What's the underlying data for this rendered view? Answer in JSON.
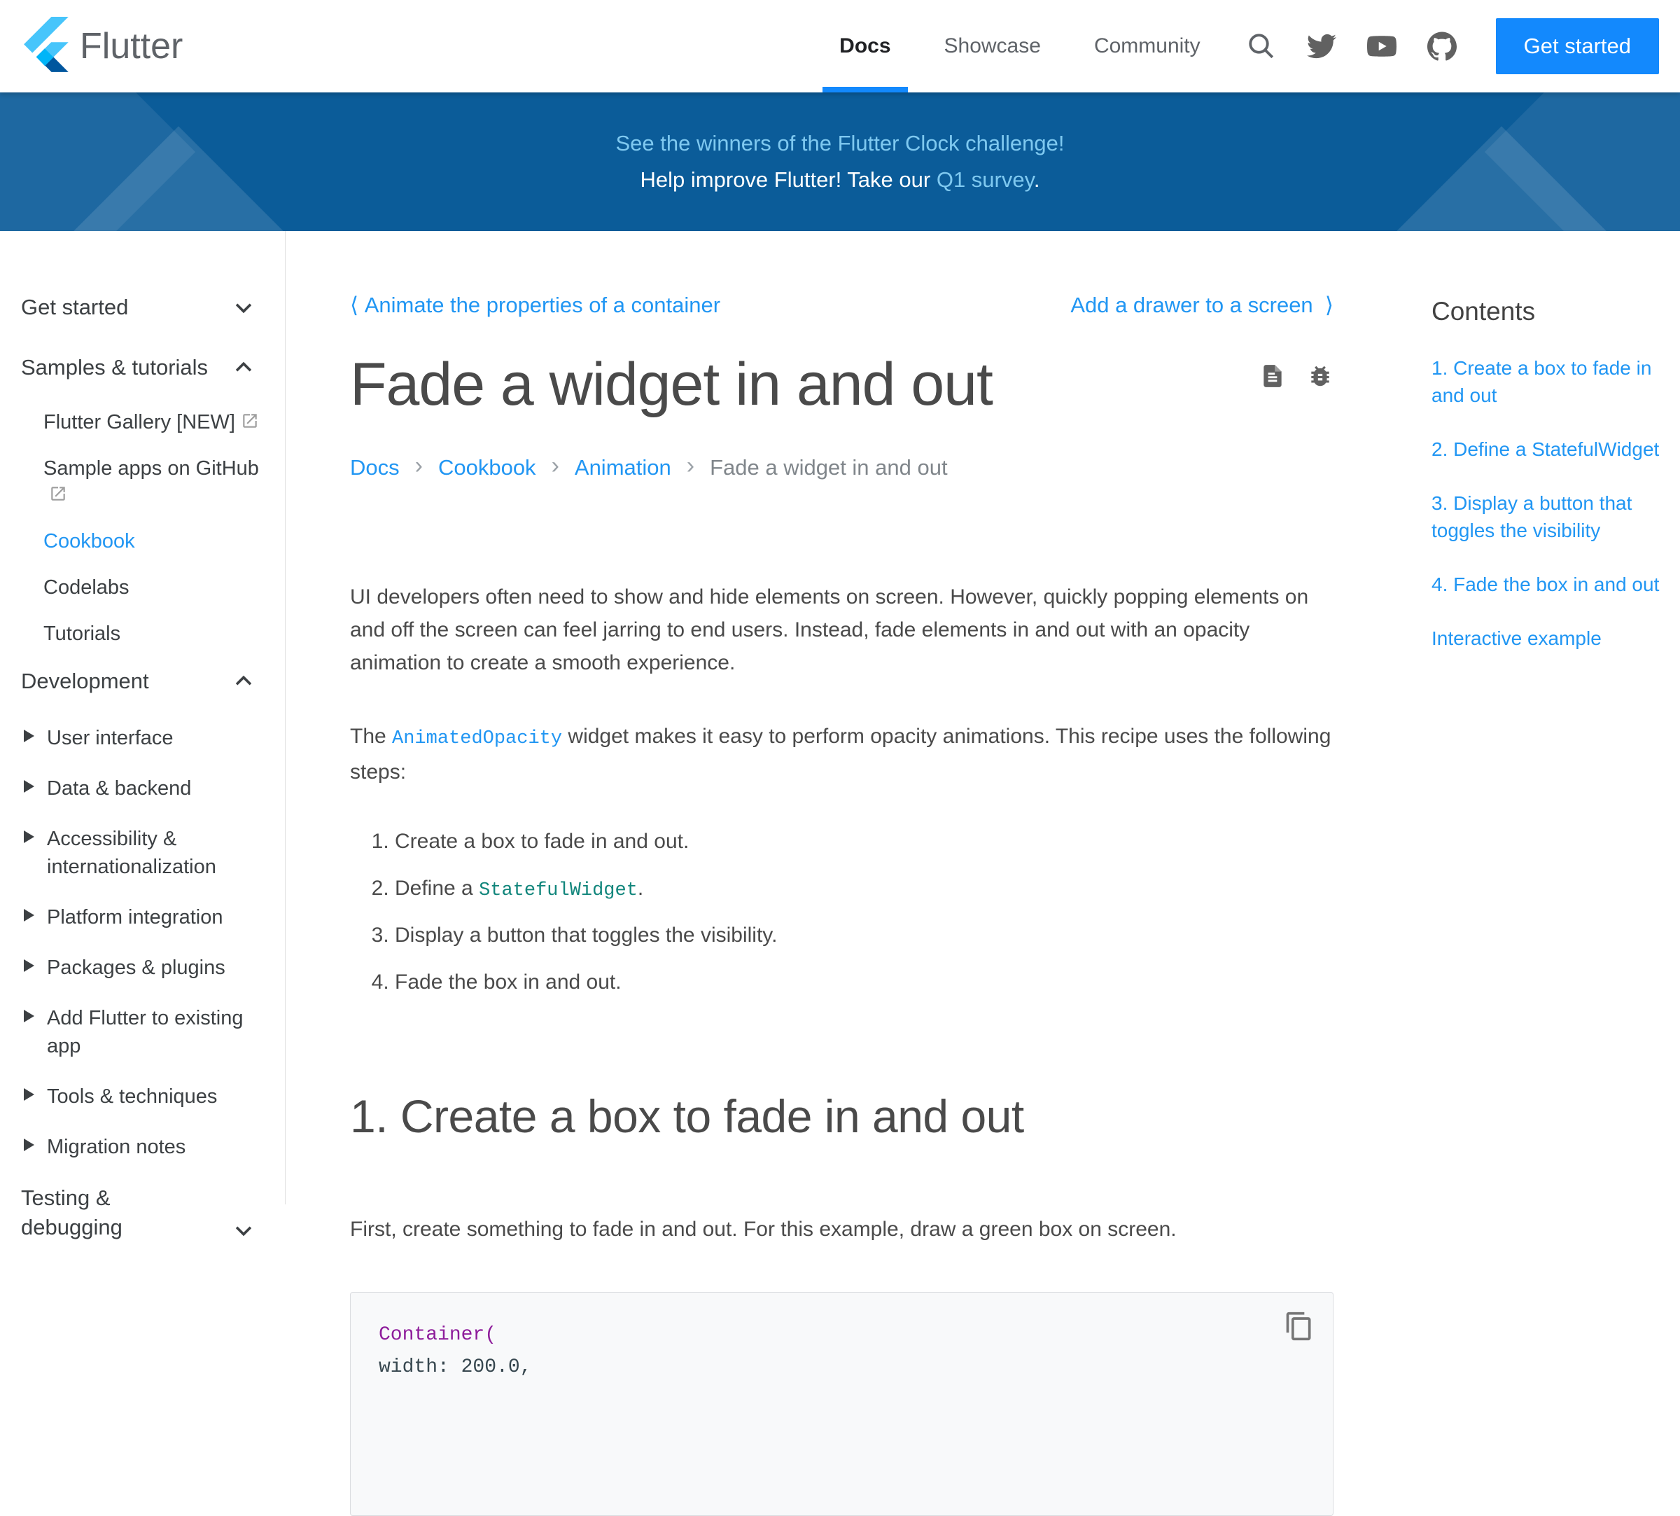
{
  "header": {
    "brand": "Flutter",
    "nav": [
      {
        "label": "Docs",
        "active": true
      },
      {
        "label": "Showcase",
        "active": false
      },
      {
        "label": "Community",
        "active": false
      }
    ],
    "icons": [
      "search-icon",
      "twitter-icon",
      "youtube-icon",
      "github-icon"
    ],
    "get_started_label": "Get started"
  },
  "banner": {
    "line1": "See the winners of the Flutter Clock challenge!",
    "line2_prefix": "Help improve Flutter! Take our ",
    "line2_link": "Q1 survey",
    "line2_suffix": "."
  },
  "sidebar": {
    "items": [
      {
        "label": "Get started",
        "type": "section",
        "chevron": "down"
      },
      {
        "label": "Samples & tutorials",
        "type": "section",
        "chevron": "up"
      },
      {
        "label": "Flutter Gallery [NEW]",
        "type": "sub",
        "external": true,
        "active": false
      },
      {
        "label": "Sample apps on GitHub",
        "type": "sub",
        "external": true,
        "active": false
      },
      {
        "label": "Cookbook",
        "type": "sub",
        "external": false,
        "active": true
      },
      {
        "label": "Codelabs",
        "type": "sub",
        "external": false,
        "active": false
      },
      {
        "label": "Tutorials",
        "type": "sub",
        "external": false,
        "active": false
      },
      {
        "label": "Development",
        "type": "section",
        "chevron": "up"
      },
      {
        "label": "User interface",
        "type": "expand"
      },
      {
        "label": "Data & backend",
        "type": "expand"
      },
      {
        "label": "Accessibility & internationalization",
        "type": "expand"
      },
      {
        "label": "Platform integration",
        "type": "expand"
      },
      {
        "label": "Packages & plugins",
        "type": "expand"
      },
      {
        "label": "Add Flutter to existing app",
        "type": "expand"
      },
      {
        "label": "Tools & techniques",
        "type": "expand"
      },
      {
        "label": "Migration notes",
        "type": "expand"
      },
      {
        "label": "Testing & debugging",
        "type": "section",
        "chevron": "down"
      }
    ]
  },
  "main": {
    "prev_link": "Animate the properties of a container",
    "next_link": "Add a drawer to a screen",
    "title": "Fade a widget in and out",
    "title_icons": [
      "document-icon",
      "bug-icon"
    ],
    "breadcrumb": {
      "links": [
        "Docs",
        "Cookbook",
        "Animation"
      ],
      "current": "Fade a widget in and out"
    },
    "p1": "UI developers often need to show and hide elements on screen. However, quickly popping elements on and off the screen can feel jarring to end users. Instead, fade elements in and out with an opacity animation to create a smooth experience.",
    "p2_prefix": "The ",
    "p2_code": "AnimatedOpacity",
    "p2_suffix": " widget makes it easy to perform opacity animations. This recipe uses the following steps:",
    "steps": [
      {
        "prefix": "Create a box to fade in and out.",
        "code": "",
        "suffix": ""
      },
      {
        "prefix": "Define a ",
        "code": "StatefulWidget",
        "suffix": "."
      },
      {
        "prefix": "Display a button that toggles the visibility.",
        "code": "",
        "suffix": ""
      },
      {
        "prefix": "Fade the box in and out.",
        "code": "",
        "suffix": ""
      }
    ],
    "section_heading": "1. Create a box to fade in and out",
    "p3": "First, create something to fade in and out. For this example, draw a green box on screen.",
    "code_block": {
      "line1": "Container(",
      "line2": "  width: 200.0,",
      "copy_icon": "copy-icon"
    }
  },
  "contents": {
    "heading": "Contents",
    "items": [
      "1. Create a box to fade in and out",
      "2. Define a StatefulWidget",
      "3. Display a button that toggles the visibility",
      "4. Fade the box in and out",
      "Interactive example"
    ]
  },
  "colors": {
    "button_blue": "#1389fd",
    "link_blue": "#2196f3",
    "banner_bg": "#0b5c99",
    "banner_link": "#7fc9f0",
    "code_purple": "#8e1d9b",
    "code_teal": "#12867c",
    "text_gray": "#4a4a4a"
  }
}
